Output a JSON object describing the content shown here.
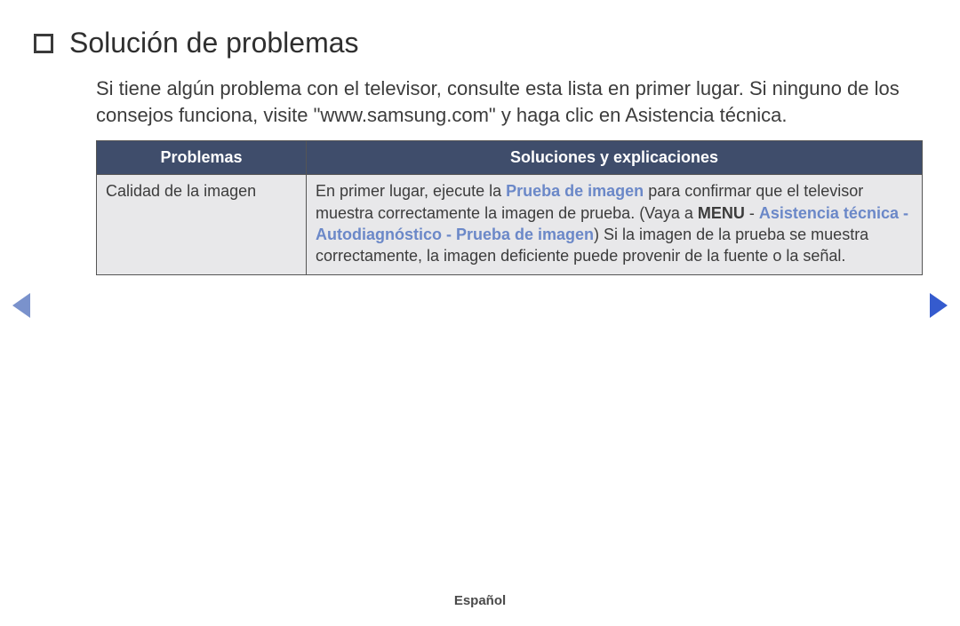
{
  "header": {
    "title": "Solución de problemas"
  },
  "intro": {
    "text": "Si tiene algún problema con el televisor, consulte esta lista en primer lugar. Si ninguno de los consejos funciona, visite \"www.samsung.com\" y haga clic en Asistencia técnica."
  },
  "table": {
    "headers": {
      "problems": "Problemas",
      "solutions": "Soluciones y explicaciones"
    },
    "row": {
      "problem": "Calidad de la imagen",
      "sol_part1": "En primer lugar, ejecute la ",
      "sol_hl1": "Prueba de imagen",
      "sol_part2": " para confirmar que el televisor muestra correctamente la imagen de prueba. (Vaya a ",
      "sol_menu": "MENU",
      "sol_part3": " - ",
      "sol_hl2": "Asistencia técnica - Autodiagnóstico - Prueba de imagen",
      "sol_part4": ") Si la imagen de la prueba se muestra correctamente, la imagen deficiente puede provenir de la fuente o la señal."
    }
  },
  "footer": {
    "language": "Español"
  }
}
